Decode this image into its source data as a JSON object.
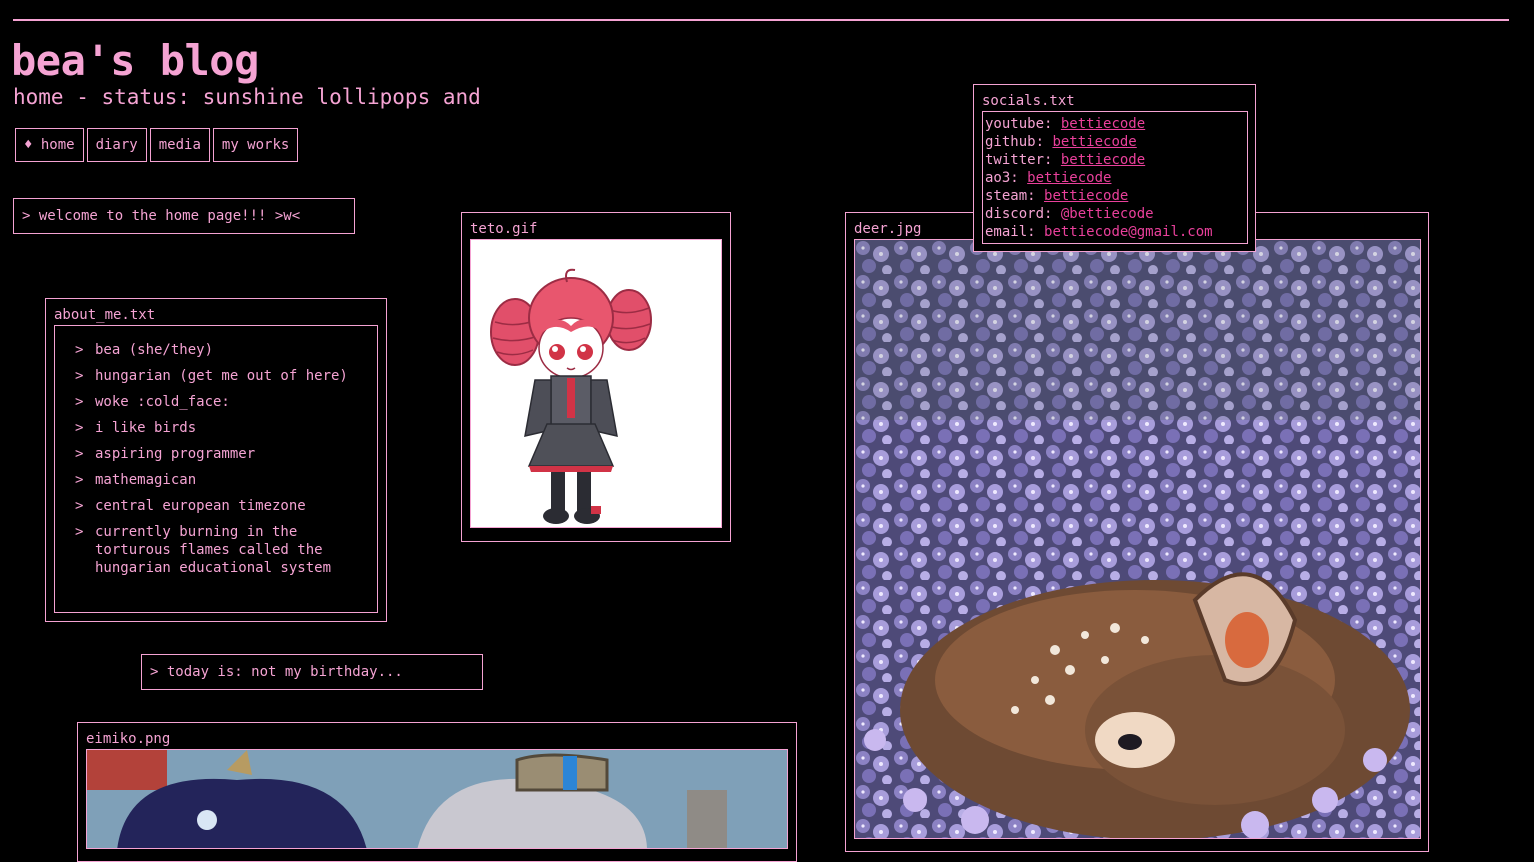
{
  "header": {
    "title": "bea's blog",
    "status": "home - status: sunshine lollipops and"
  },
  "nav": [
    {
      "label": "♦ home"
    },
    {
      "label": "diary"
    },
    {
      "label": "media"
    },
    {
      "label": "my works"
    }
  ],
  "welcome": "> welcome to the home page!!! >w<",
  "birthday": "> today is: not my birthday...",
  "about": {
    "title": "about_me.txt",
    "items": [
      "bea (she/they)",
      "hungarian (get me out of here)",
      "woke :cold_face:",
      "i like birds",
      "aspiring programmer",
      "mathemagican",
      "central european timezone",
      "currently burning in the torturous flames called the hungarian educational system"
    ]
  },
  "teto": {
    "title": "teto.gif"
  },
  "deer": {
    "title": "deer.jpg"
  },
  "eimiko": {
    "title": "eimiko.png"
  },
  "socials": {
    "title": "socials.txt",
    "rows": [
      {
        "label": "youtube:",
        "value": "bettiecode"
      },
      {
        "label": "github:",
        "value": "bettiecode"
      },
      {
        "label": "twitter:",
        "value": "bettiecode"
      },
      {
        "label": "ao3:",
        "value": "bettiecode"
      },
      {
        "label": "steam:",
        "value": "bettiecode"
      },
      {
        "label": "discord:",
        "value": "@bettiecode"
      },
      {
        "label": "email:",
        "value": "bettiecode@gmail.com"
      }
    ]
  },
  "colors": {
    "background": "#000000",
    "accent": "#f5a3d3",
    "link": "#e9409b"
  }
}
